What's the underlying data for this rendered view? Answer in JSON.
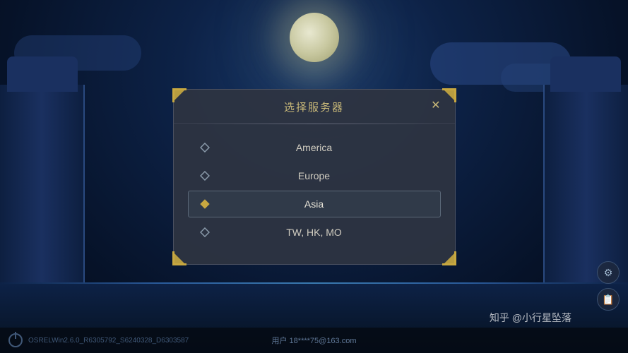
{
  "background": {
    "moon_alt": "moon"
  },
  "modal": {
    "title": "选择服务器",
    "close_label": "✕",
    "servers": [
      {
        "id": "america",
        "name": "America",
        "selected": false
      },
      {
        "id": "europe",
        "name": "Europe",
        "selected": false
      },
      {
        "id": "asia",
        "name": "Asia",
        "selected": true
      },
      {
        "id": "twhkmo",
        "name": "TW, HK, MO",
        "selected": false
      }
    ]
  },
  "bottom_bar": {
    "version": "OSRELWin2.6.0_R6305792_S6240328_D6303587",
    "user_label": "用户",
    "user_email": "18****75@163.com"
  },
  "watermark": {
    "text": "知乎 @小行星坠落"
  },
  "side_icons": {
    "wrench": "🔧",
    "calendar": "📅"
  }
}
